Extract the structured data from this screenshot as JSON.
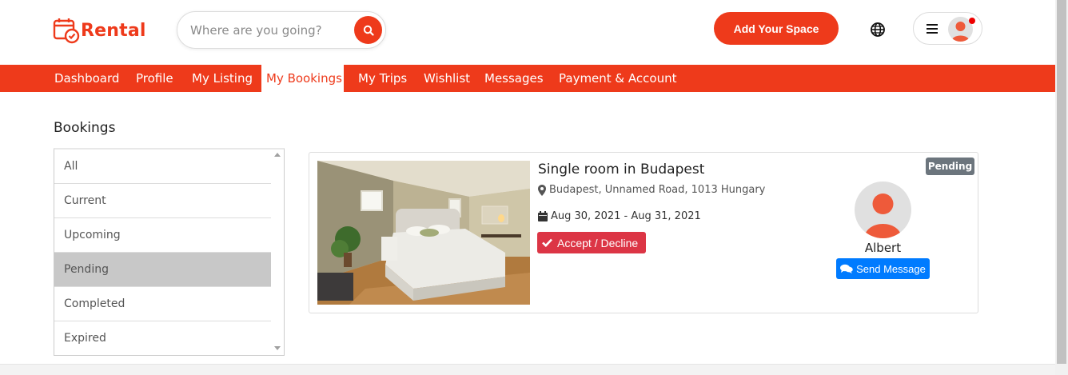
{
  "brand": {
    "name": "Rental",
    "accent": "#ee3a1b"
  },
  "search": {
    "placeholder": "Where are you going?",
    "value": ""
  },
  "header": {
    "add_space_label": "Add Your Space"
  },
  "nav": {
    "items": [
      {
        "label": "Dashboard"
      },
      {
        "label": "Profile"
      },
      {
        "label": "My Listing"
      },
      {
        "label": "My Bookings",
        "active": true
      },
      {
        "label": "My Trips"
      },
      {
        "label": "Wishlist"
      },
      {
        "label": "Messages"
      },
      {
        "label": "Payment & Account"
      }
    ]
  },
  "bookings": {
    "title": "Bookings",
    "filters": [
      "All",
      "Current",
      "Upcoming",
      "Pending",
      "Completed",
      "Expired"
    ],
    "selected_filter": "Pending"
  },
  "booking_card": {
    "title": "Single room in Budapest",
    "location": "Budapest, Unnamed Road, 1013 Hungary",
    "dates": "Aug 30, 2021 - Aug 31, 2021",
    "action_label": "Accept / Decline",
    "status": "Pending",
    "host_name": "Albert",
    "message_label": "Send Message"
  },
  "icons": {
    "logo": "calendar-check-icon",
    "search": "search-icon",
    "globe": "globe-icon",
    "menu": "hamburger-icon",
    "location": "map-marker-icon",
    "dates": "calendar-icon",
    "accept": "check-icon",
    "message": "chat-bubbles-icon"
  },
  "colors": {
    "nav_bg": "#ee3a1b",
    "danger": "#dc3545",
    "primary": "#007bff",
    "badge": "#6c757d"
  }
}
